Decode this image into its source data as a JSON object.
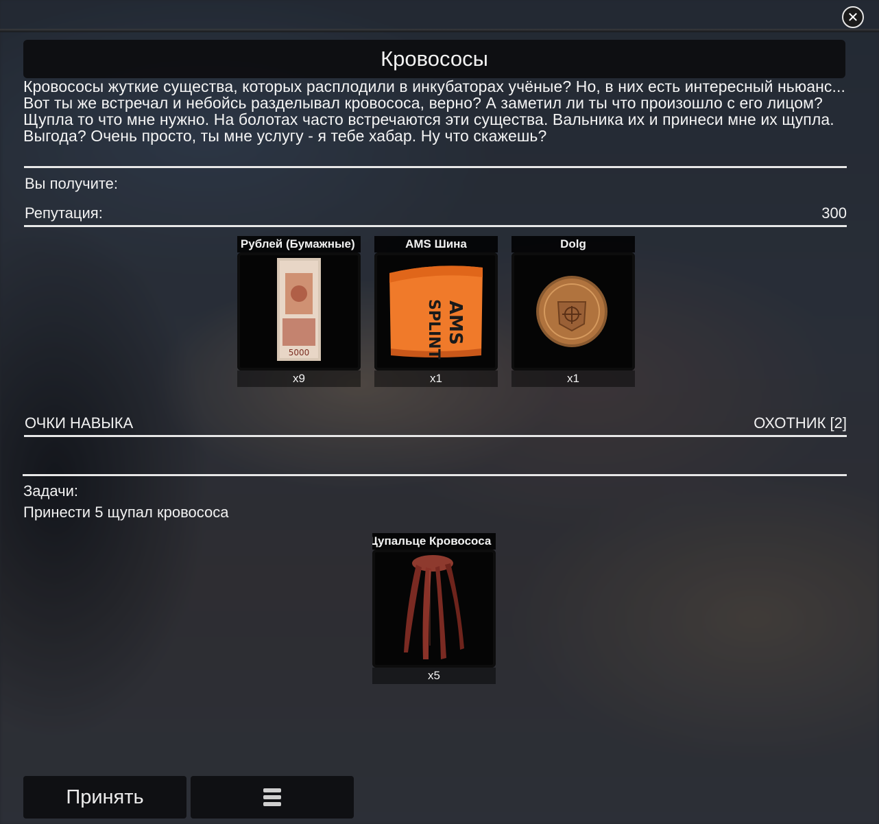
{
  "quest": {
    "title": "Кровососы",
    "description": "Кровососы жуткие существа, которых расплодили в инкубаторах учёные? Но, в них есть интересный ньюанс... Вот ты же встречал и небойсь разделывал кровососа, верно? А заметил ли ты что произошло с его лицом? Щупла то что мне нужно. На болотах часто встречаются эти существа. Вальника их и принеси мне их щупла. Выгода? Очень просто, ты мне услугу - я тебе хабар. Ну что скажешь?"
  },
  "rewards": {
    "heading": "Вы получите:",
    "reputation_label": "Репутация:",
    "reputation_value": "300",
    "items": [
      {
        "name": "5000 Рублей (Бумажные)",
        "qty": "x9",
        "icon": "banknote-icon"
      },
      {
        "name": "AMS Шина",
        "qty": "x1",
        "icon": "splint-icon"
      },
      {
        "name": "Dolg",
        "qty": "x1",
        "icon": "faction-coin-icon"
      }
    ],
    "skill_label": "ОЧКИ НАВЫКА",
    "skill_value": "ОХОТНИК [2]"
  },
  "tasks": {
    "heading": "Задачи:",
    "objective": "Принести 5 щупал кровососа",
    "items": [
      {
        "name": "Щупальце Кровососа",
        "qty": "x5",
        "icon": "tentacle-icon"
      }
    ]
  },
  "buttons": {
    "accept": "Принять",
    "menu_icon": "stack-icon"
  },
  "colors": {
    "splint_orange": "#f07a2a",
    "coin_bronze": "#b0733e",
    "tentacle_red": "#7a2a22"
  }
}
